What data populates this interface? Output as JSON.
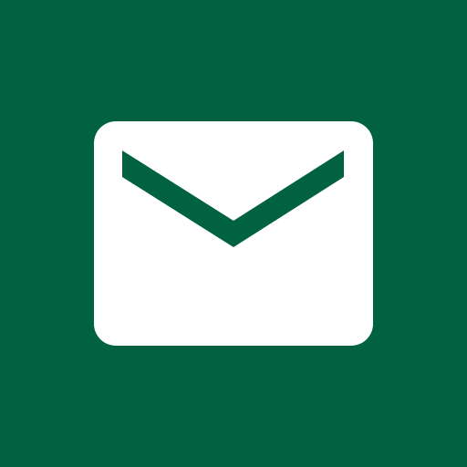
{
  "icon": {
    "name": "mail-icon",
    "background_color": "#006241",
    "envelope_color": "#ffffff"
  }
}
